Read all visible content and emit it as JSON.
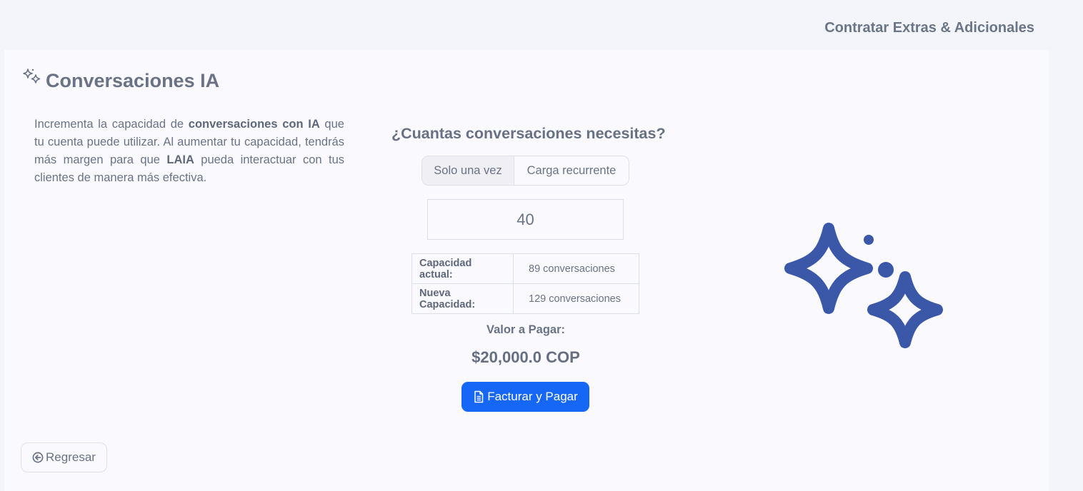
{
  "header": {
    "title": "Contratar Extras & Adicionales"
  },
  "card": {
    "title": "Conversaciones IA",
    "title_icon": "sparkles-icon",
    "description": {
      "part1": "Incrementa la capacidad de ",
      "bold1": "conversaciones con IA",
      "part2": " que tu cuenta puede utilizar. Al aumentar tu capacidad, tendrás más margen para que ",
      "bold2": "LAIA",
      "part3": " pueda interactuar con tus clientes de manera más efectiva."
    }
  },
  "form": {
    "question": "¿Cuantas conversaciones necesitas?",
    "toggle": {
      "selected": "Solo una vez",
      "options": [
        "Solo una vez",
        "Carga recurrente"
      ]
    },
    "quantity": "40",
    "capacity": {
      "current_label": "Capacidad actual:",
      "current_value": "89 conversaciones",
      "new_label": "Nueva Capacidad:",
      "new_value": "129 conversaciones"
    },
    "pay_label": "Valor a Pagar:",
    "pay_amount": "$20,000.0 COP",
    "pay_button": "Facturar y Pagar",
    "pay_button_icon": "file-text-icon"
  },
  "illustration": {
    "icon": "sparkles-icon",
    "color": "#3a57a8"
  },
  "back_button": {
    "label": "Regresar",
    "icon": "arrow-circle-left-icon"
  },
  "colors": {
    "accent": "#1767f6",
    "text": "#6a7385",
    "background": "#f4f5fb"
  }
}
